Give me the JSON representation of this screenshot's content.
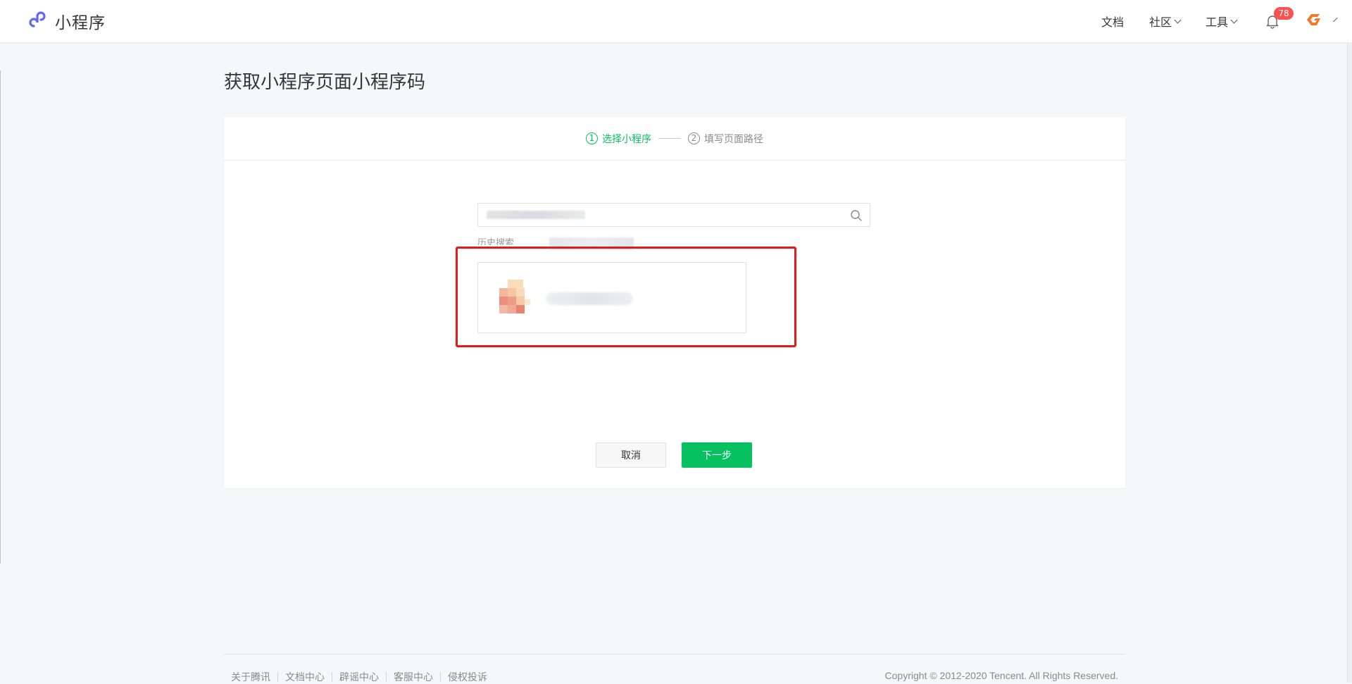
{
  "header": {
    "brand": "小程序",
    "nav": [
      {
        "label": "文档",
        "dropdown": false
      },
      {
        "label": "社区",
        "dropdown": true
      },
      {
        "label": "工具",
        "dropdown": true
      }
    ],
    "notification_count": "78",
    "avatar_icon": "user-avatar-icon"
  },
  "page": {
    "title": "获取小程序页面小程序码"
  },
  "steps": [
    {
      "number": "1",
      "label": "选择小程序",
      "active": true
    },
    {
      "number": "2",
      "label": "填写页面路径",
      "active": false
    }
  ],
  "search": {
    "placeholder": "",
    "value": ""
  },
  "history": {
    "label": "历史搜索"
  },
  "buttons": {
    "cancel": "取消",
    "next": "下一步"
  },
  "footer": {
    "links": [
      "关于腾讯",
      "文档中心",
      "辟谣中心",
      "客服中心",
      "侵权投诉"
    ],
    "copyright": "Copyright © 2012-2020 Tencent. All Rights Reserved."
  },
  "colors": {
    "brand_green": "#07c160",
    "badge_red": "#fa5151",
    "highlight_red": "#e51919",
    "logo_purple": "#6467f0"
  }
}
